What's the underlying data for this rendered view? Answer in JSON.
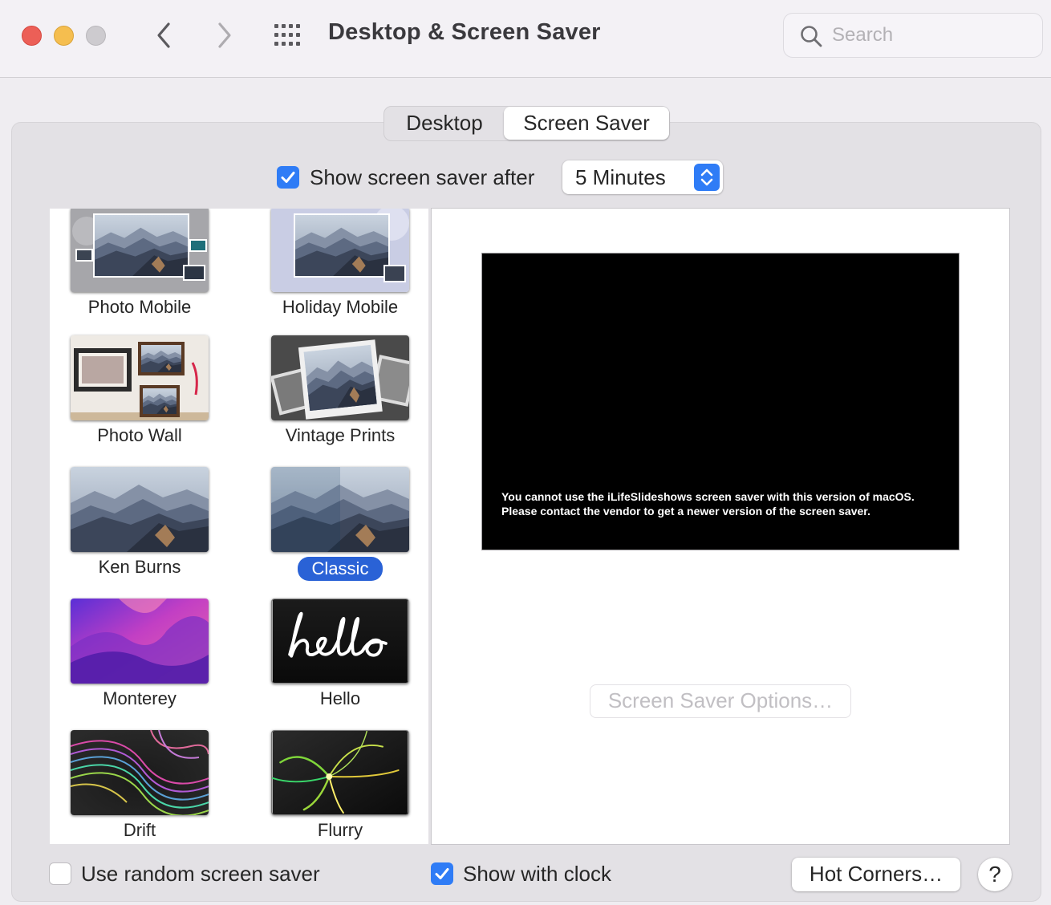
{
  "window": {
    "title": "Desktop & Screen Saver",
    "search_placeholder": "Search"
  },
  "tabs": [
    {
      "label": "Desktop",
      "selected": false
    },
    {
      "label": "Screen Saver",
      "selected": true
    }
  ],
  "show_after": {
    "label": "Show screen saver after",
    "checked": true,
    "value": "5 Minutes"
  },
  "savers": [
    {
      "label": "Photo Mobile",
      "selected": false
    },
    {
      "label": "Holiday Mobile",
      "selected": false
    },
    {
      "label": "Photo Wall",
      "selected": false
    },
    {
      "label": "Vintage Prints",
      "selected": false
    },
    {
      "label": "Ken Burns",
      "selected": false
    },
    {
      "label": "Classic",
      "selected": true
    },
    {
      "label": "Monterey",
      "selected": false
    },
    {
      "label": "Hello",
      "selected": false
    },
    {
      "label": "Drift",
      "selected": false
    },
    {
      "label": "Flurry",
      "selected": false
    }
  ],
  "preview": {
    "message_line1": "You cannot use the iLifeSlideshows screen saver with this version of macOS.",
    "message_line2": "Please contact the vendor to get a newer version of the screen saver.",
    "options_label": "Screen Saver Options…"
  },
  "bottom": {
    "random_label": "Use random screen saver",
    "random_checked": false,
    "clock_label": "Show with clock",
    "clock_checked": true,
    "hot_corners_label": "Hot Corners…",
    "help_label": "?"
  },
  "colors": {
    "accent": "#2f7cf6",
    "selection": "#2a62d6",
    "close": "#ec5f57",
    "minimize": "#f5be4f",
    "zoom_disabled": "#cdcbcf"
  }
}
